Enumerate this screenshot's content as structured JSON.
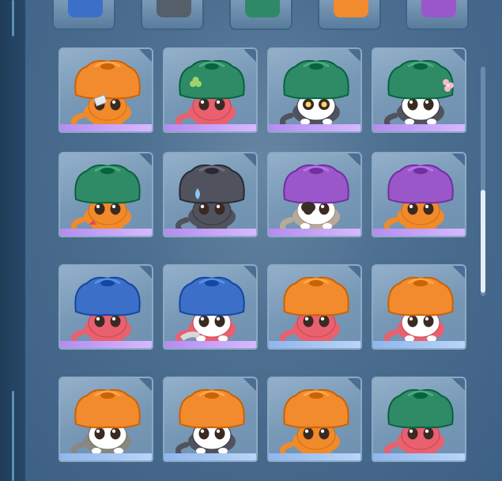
{
  "top_row": [
    {
      "hat_color": "#3b6fc8",
      "variant": "blue"
    },
    {
      "hat_color": "#555f6a",
      "variant": "gray"
    },
    {
      "hat_color": "#2e8a66",
      "variant": "green"
    },
    {
      "hat_color": "#f28a2e",
      "variant": "orange"
    },
    {
      "hat_color": "#9a57c9",
      "variant": "purple"
    }
  ],
  "grid": [
    [
      {
        "hat": "#f28a2e",
        "body": "#f08a2a",
        "face": "#f08a2a",
        "frame": "purple",
        "accessory": "bandage"
      },
      {
        "hat": "#2f8a66",
        "body": "#e9606f",
        "face": "#e9606f",
        "frame": "purple",
        "accessory": "clover"
      },
      {
        "hat": "#2f8a66",
        "body": "#50535e",
        "face": "#ffffff",
        "frame": "purple",
        "accessory": "star-eyes"
      },
      {
        "hat": "#2f8a66",
        "body": "#50535e",
        "face": "#ffffff",
        "frame": "purple",
        "accessory": "flower"
      }
    ],
    [
      {
        "hat": "#2f8a66",
        "body": "#f08a2a",
        "face": "#f08a2a",
        "frame": "purple",
        "accessory": "ribbon"
      },
      {
        "hat": "#50535e",
        "body": "#50535e",
        "face": "#50535e",
        "frame": "purple",
        "accessory": "water-drop"
      },
      {
        "hat": "#9a57c9",
        "body": "#b8aa9a",
        "face": "#ffffff",
        "frame": "purple",
        "accessory": "eyepatch"
      },
      {
        "hat": "#9a57c9",
        "body": "#f08a2a",
        "face": "#f08a2a",
        "frame": "purple",
        "accessory": "none"
      }
    ],
    [
      {
        "hat": "#3b6fc8",
        "body": "#e9606f",
        "face": "#e9606f",
        "frame": "purple",
        "accessory": "none"
      },
      {
        "hat": "#3b6fc8",
        "body": "#e9606f",
        "face": "#ffffff",
        "frame": "purple",
        "accessory": "bandaged-tail"
      },
      {
        "hat": "#f28a2e",
        "body": "#e9606f",
        "face": "#e9606f",
        "frame": "blue",
        "accessory": "none"
      },
      {
        "hat": "#f28a2e",
        "body": "#e9606f",
        "face": "#ffffff",
        "frame": "blue",
        "accessory": "none"
      }
    ],
    [
      {
        "hat": "#f28a2e",
        "body": "#8a8780",
        "face": "#ffffff",
        "frame": "blue",
        "accessory": "none"
      },
      {
        "hat": "#f28a2e",
        "body": "#50535e",
        "face": "#ffffff",
        "frame": "blue",
        "accessory": "none"
      },
      {
        "hat": "#f28a2e",
        "body": "#f08a2a",
        "face": "#f08a2a",
        "frame": "blue",
        "accessory": "none"
      },
      {
        "hat": "#2f8a66",
        "body": "#e9606f",
        "face": "#e9606f",
        "frame": "blue",
        "accessory": "none"
      }
    ]
  ]
}
